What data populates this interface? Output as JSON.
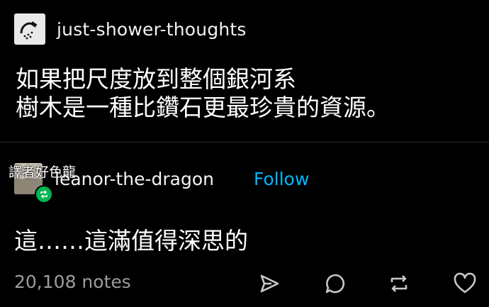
{
  "post": {
    "blog_name": "just-shower-thoughts",
    "body_lines": [
      "如果把尺度放到整個銀河系",
      "樹木是一種比鑽石更最珍貴的資源。"
    ]
  },
  "reblog": {
    "watermark": "譯者好色龍",
    "username": "leanor-the-dragon",
    "follow_label": "Follow",
    "text": "這……這滿值得深思的"
  },
  "footer": {
    "notes": "20,108 notes",
    "actions": [
      "share-icon",
      "reply-icon",
      "reblog-icon",
      "like-icon"
    ]
  },
  "colors": {
    "background": "#000000",
    "text": "#ffffff",
    "muted": "#9c9c9c",
    "follow": "#00b8ff",
    "reblog_badge": "#00b651"
  }
}
